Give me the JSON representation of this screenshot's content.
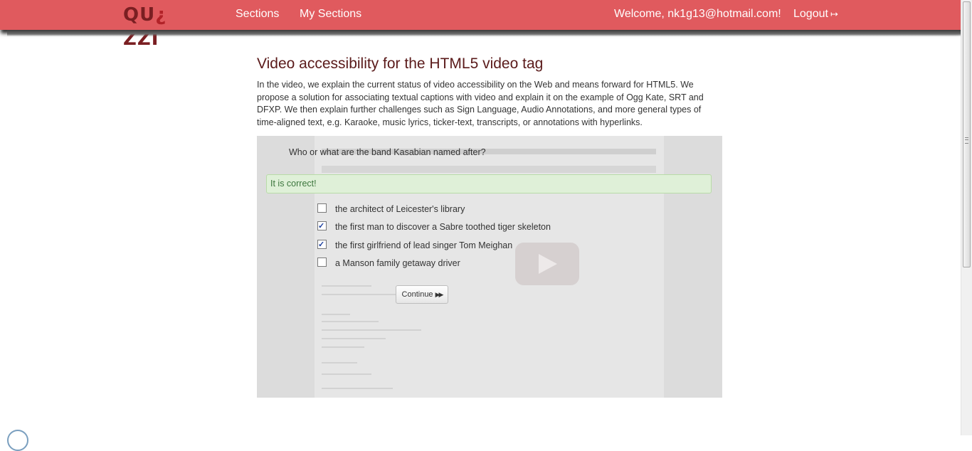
{
  "navbar": {
    "logo_text": "QU",
    "logo_mark": "¿",
    "logo_text_end": "ZZI",
    "sections_label": "Sections",
    "my_sections_label": "My Sections",
    "welcome_text": "Welcome, nk1g13@hotmail.com!",
    "logout_label": "Logout",
    "logout_icon": "sign-out-icon"
  },
  "page": {
    "title": "Video accessibility for the HTML5 video tag",
    "description": "In the video, we explain the current status of video accessibility on the Web and means forward for HTML5. We propose a solution for associating textual captions with video and explain it on the example of Ogg Kate, SRT and DFXP. We then explain further challenges such as Sign Language, Audio Annotations, and more general types of time-aligned text, e.g. Karaoke, music lyrics, ticker-text, transcripts, or annotations with hyperlinks."
  },
  "quiz": {
    "question": "Who or what are the band Kasabian named after?",
    "feedback": "It is correct!",
    "options": [
      {
        "label": "the architect of Leicester's library",
        "checked": false
      },
      {
        "label": "the first man to discover a Sabre toothed tiger skeleton",
        "checked": true
      },
      {
        "label": "the first girlfriend of lead singer Tom Meighan",
        "checked": true
      },
      {
        "label": "a Manson family getaway driver",
        "checked": false
      }
    ],
    "continue_label": "Continue",
    "continue_icon": "fast-forward-icon"
  },
  "colors": {
    "navbar": "#e05a5e",
    "title": "#5a1a1a",
    "success_bg": "#dff0d8",
    "success_text": "#3c763d"
  }
}
